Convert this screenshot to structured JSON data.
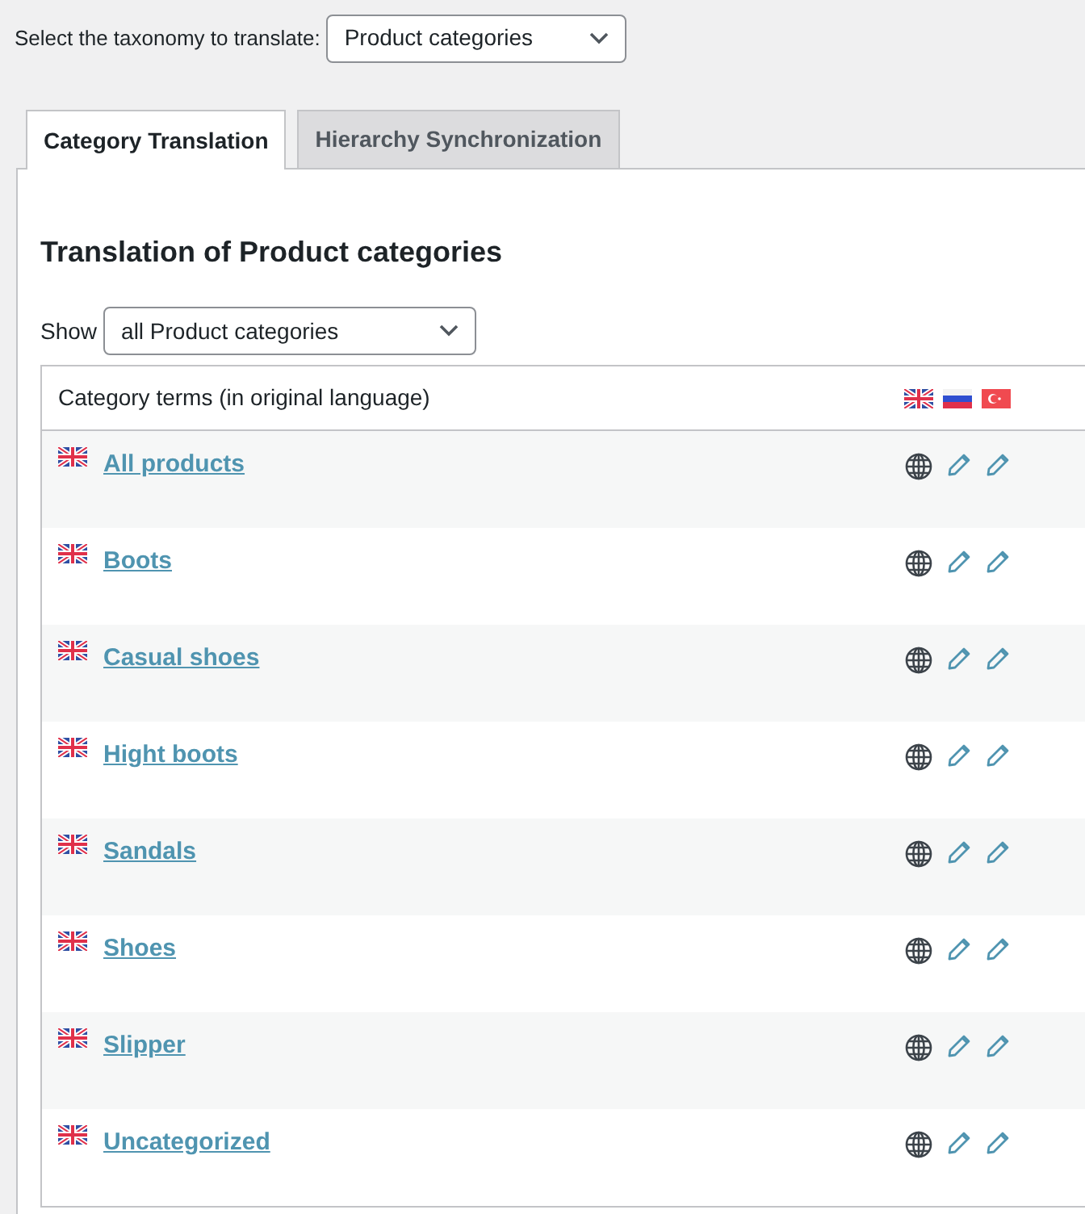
{
  "taxonomy_selector": {
    "label": "Select the taxonomy to translate:",
    "value": "Product categories"
  },
  "tabs": [
    {
      "label": "Category Translation",
      "selected": true
    },
    {
      "label": "Hierarchy Synchronization",
      "selected": false
    }
  ],
  "panel": {
    "title": "Translation of Product categories",
    "filter": {
      "label": "Show",
      "value": "all Product categories"
    },
    "table": {
      "header": "Category terms (in original language)",
      "rows": [
        {
          "name": "All products"
        },
        {
          "name": "Boots"
        },
        {
          "name": "Casual shoes"
        },
        {
          "name": "Hight boots"
        },
        {
          "name": "Sandals"
        },
        {
          "name": "Shoes"
        },
        {
          "name": "Slipper"
        },
        {
          "name": "Uncategorized"
        }
      ]
    }
  }
}
